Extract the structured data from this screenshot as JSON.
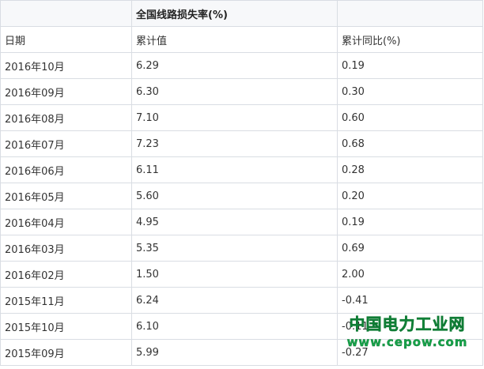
{
  "table": {
    "title": "全国线路损失率(%)",
    "headers": [
      "日期",
      "累计值",
      "累计同比(%)"
    ],
    "rows": [
      [
        "2016年10月",
        "6.29",
        "0.19"
      ],
      [
        "2016年09月",
        "6.30",
        "0.30"
      ],
      [
        "2016年08月",
        "7.10",
        "0.60"
      ],
      [
        "2016年07月",
        "7.23",
        "0.68"
      ],
      [
        "2016年06月",
        "6.11",
        "0.28"
      ],
      [
        "2016年05月",
        "5.60",
        "0.20"
      ],
      [
        "2016年04月",
        "4.95",
        "0.19"
      ],
      [
        "2016年03月",
        "5.35",
        "0.69"
      ],
      [
        "2016年02月",
        "1.50",
        "2.00"
      ],
      [
        "2015年11月",
        "6.24",
        "-0.41"
      ],
      [
        "2015年10月",
        "6.10",
        "-0.11"
      ],
      [
        "2015年09月",
        "5.99",
        "-0.27"
      ]
    ]
  },
  "watermark": {
    "name": "中国电力工业网",
    "url": "www.cepow.com",
    "color": "#16a34a"
  }
}
